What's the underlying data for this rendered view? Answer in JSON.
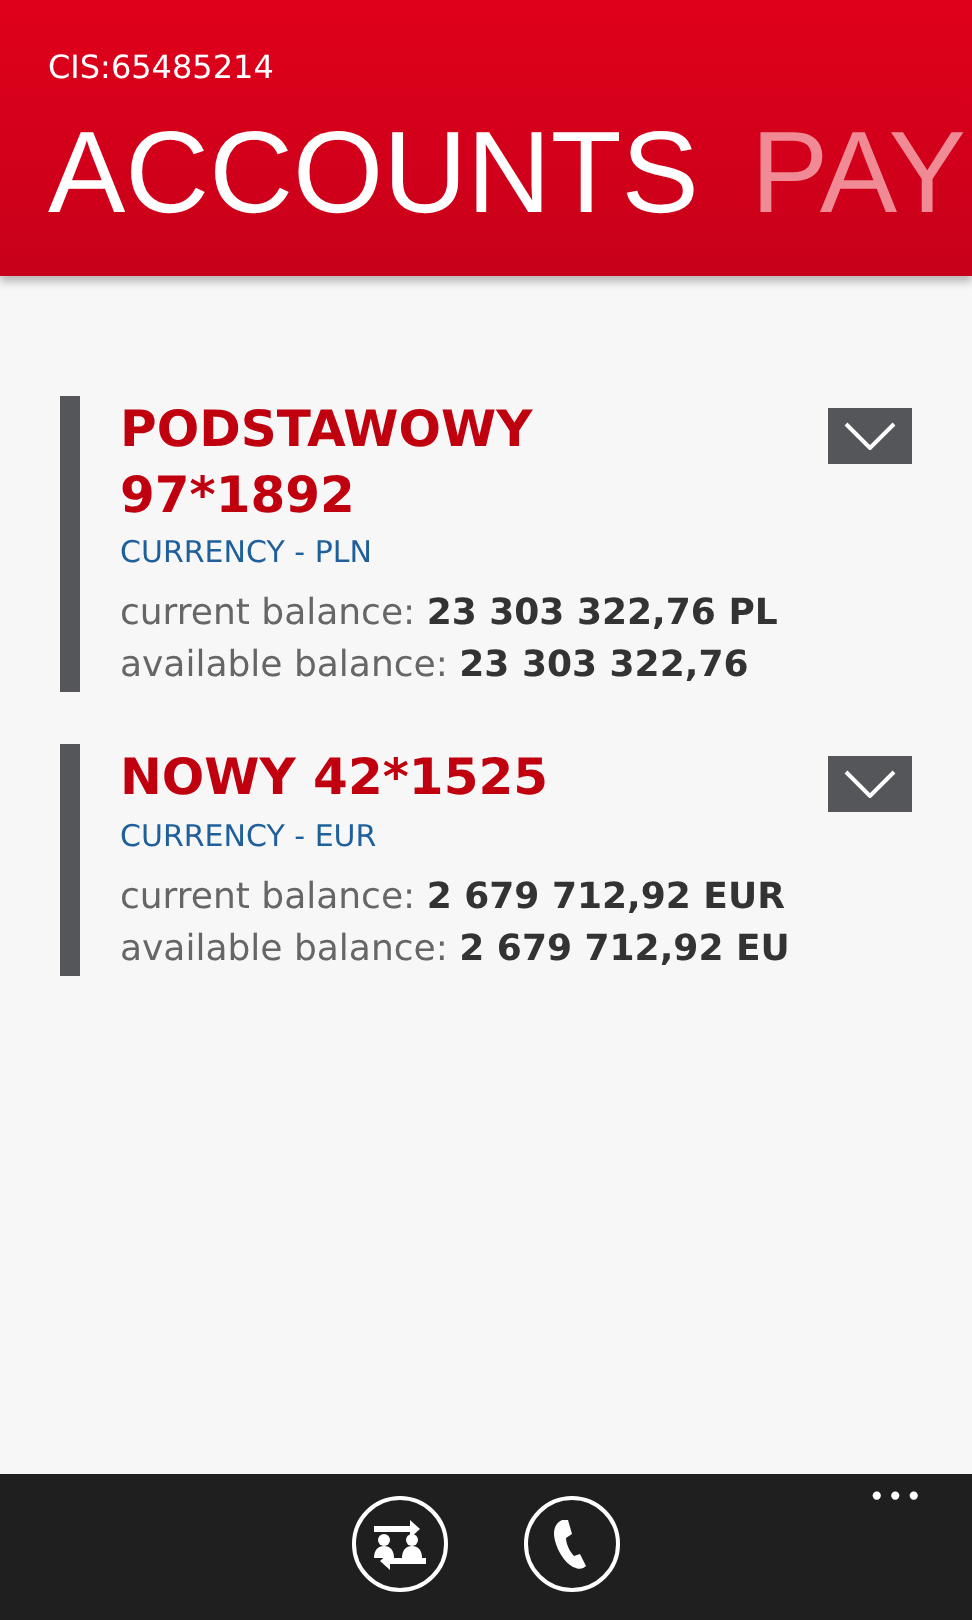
{
  "header": {
    "cis": "CIS:65485214",
    "pivots": [
      {
        "label": "ACCOUNTS",
        "selected": true
      },
      {
        "label": "PAY",
        "selected": false
      }
    ]
  },
  "accounts": [
    {
      "name": "PODSTAWOWY 97*1892",
      "currency": "CURRENCY - PLN",
      "balances": [
        {
          "label": "current balance:",
          "value": "23 303 322,76 PL"
        },
        {
          "label": "available balance:",
          "value": "23 303 322,76"
        }
      ]
    },
    {
      "name": "NOWY 42*1525",
      "currency": "CURRENCY - EUR",
      "balances": [
        {
          "label": "current balance:",
          "value": "2 679 712,92 EUR"
        },
        {
          "label": "available balance:",
          "value": "2 679 712,92 EU"
        }
      ]
    }
  ],
  "app_bar": {
    "buttons": [
      {
        "kind": "transfer"
      },
      {
        "kind": "phone"
      }
    ],
    "more": "•••"
  }
}
